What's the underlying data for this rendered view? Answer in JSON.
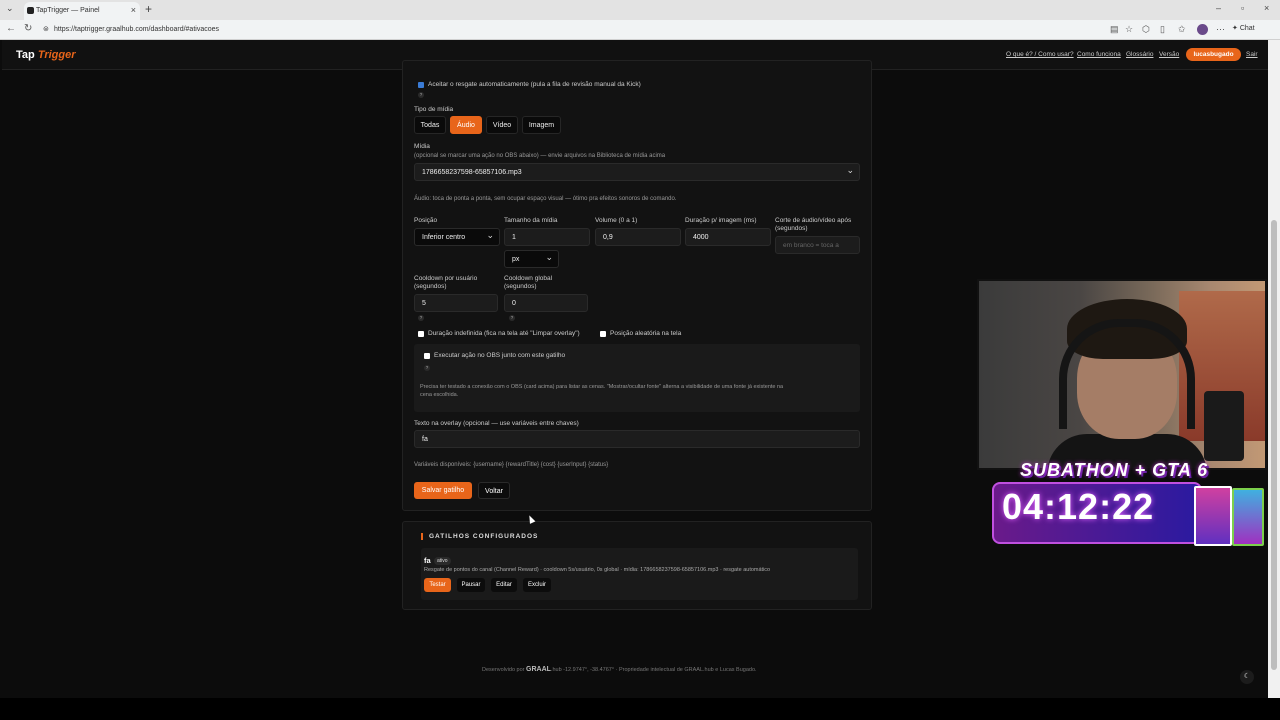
{
  "browser": {
    "tab_title": "TapTrigger — Painel",
    "url": "https://taptrigger.graalhub.com/dashboard/#ativacoes",
    "chat_label": "Chat"
  },
  "header": {
    "logo_left": "Tap",
    "logo_right": "Trigger",
    "links": [
      "O que é? / Como usar?",
      "Como funciona",
      "Glossário",
      "Versão"
    ],
    "username": "lucasbugado",
    "logout": "Sair"
  },
  "form": {
    "auto_redeem_label": "Aceitar o resgate automaticamente (pula a fila de revisão manual da Kick)",
    "auto_redeem_checked": true,
    "media_type_label": "Tipo de mídia",
    "media_types": [
      "Todas",
      "Áudio",
      "Vídeo",
      "Imagem"
    ],
    "media_type_selected": "Áudio",
    "media_label": "Mídia",
    "media_hint": "(opcional se marcar uma ação no OBS abaixo) — envie arquivos na Biblioteca de mídia acima",
    "media_value": "1786658237598-65857106.mp3",
    "audio_note": "Áudio: toca de ponta a ponta, sem ocupar espaço visual — ótimo pra efeitos sonoros de comando.",
    "position_label": "Posição",
    "position_value": "Inferior centro",
    "size_label": "Tamanho da mídia",
    "size_value": "1",
    "size_unit": "px",
    "volume_label": "Volume (0 a 1)",
    "volume_value": "0,9",
    "duration_label": "Duração p/ imagem (ms)",
    "duration_value": "4000",
    "cut_label_1": "Corte de áudio/vídeo após",
    "cut_label_2": "(segundos)",
    "cut_placeholder": "em branco = toca a",
    "cooldown_user_label_1": "Cooldown por usuário",
    "cooldown_user_label_2": "(segundos)",
    "cooldown_user_value": "5",
    "cooldown_global_label_1": "Cooldown global",
    "cooldown_global_label_2": "(segundos)",
    "cooldown_global_value": "0",
    "indefinite_label": "Duração indefinida (fica na tela até \"Limpar overlay\")",
    "random_pos_label": "Posição aleatória na tela",
    "obs_action_label": "Executar ação no OBS junto com este gatilho",
    "obs_note_1": "Precisa ter testado a conexão com o OBS (card acima) para listar as cenas. \"Mostrar/ocultar fonte\" alterna a visibilidade de uma fonte já existente na",
    "obs_note_2": "cena escolhida.",
    "overlay_text_label": "Texto na overlay (opcional — use variáveis entre chaves)",
    "overlay_text_value": "fa",
    "variables_label": "Variáveis disponíveis: {username} {rewardTitle} {cost} {userInput} {status}",
    "save_button": "Salvar gatilho",
    "back_button": "Voltar"
  },
  "triggers": {
    "title": "GATILHOS CONFIGURADOS",
    "items": [
      {
        "name": "fa",
        "badge": "ativo",
        "description": "Resgate de pontos do canal (Channel Reward) · cooldown 5s/usuário, 0s global · mídia: 1786658237598-65857106.mp3 · resgate automático",
        "actions": [
          "Testar",
          "Pausar",
          "Editar",
          "Excluir"
        ]
      }
    ]
  },
  "footer": {
    "prefix": "Desenvolvido por",
    "brand": "GRAAL",
    "brand_suffix": ".hub",
    "coords": "-12.9747°, -38.4767°",
    "rights": "· Propriedade intelectual de GRAAL.hub e Lucas Bugado."
  },
  "overlay": {
    "title": "SUBATHON + GTA 6",
    "timer": "04:12:22"
  },
  "colors": {
    "accent": "#e8651a",
    "background": "#0c0c0c",
    "panel": "#121212"
  }
}
